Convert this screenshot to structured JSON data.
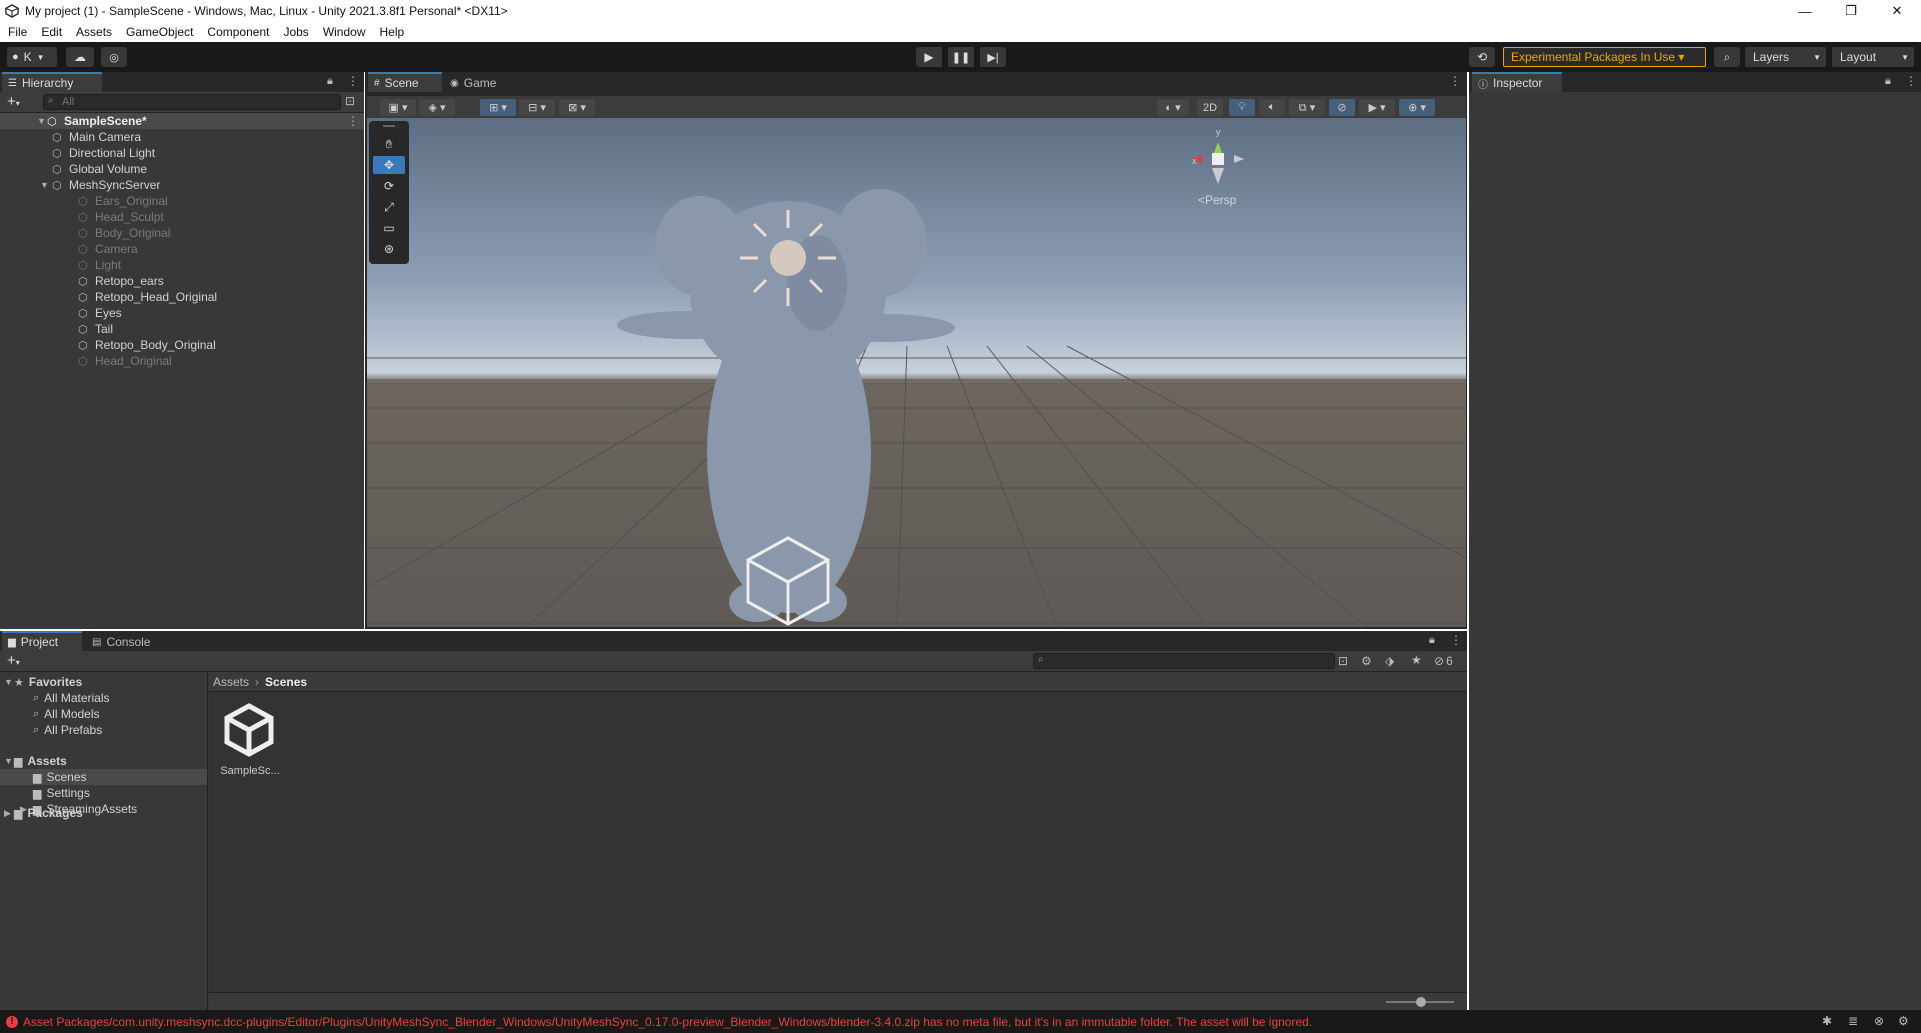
{
  "window": {
    "title": "My project (1) - SampleScene - Windows, Mac, Linux - Unity 2021.3.8f1 Personal* <DX11>",
    "minimize": "—",
    "maximize": "❐",
    "close": "✕"
  },
  "menu": [
    "File",
    "Edit",
    "Assets",
    "GameObject",
    "Component",
    "Jobs",
    "Window",
    "Help"
  ],
  "toolbar": {
    "account_label": "K",
    "experimental_label": "Experimental Packages In Use ▾",
    "layers_label": "Layers",
    "layout_label": "Layout"
  },
  "hierarchy": {
    "tab": "Hierarchy",
    "search_placeholder": "All",
    "scene": "SampleScene*",
    "items": [
      {
        "label": "Main Camera",
        "dim": false
      },
      {
        "label": "Directional Light",
        "dim": false
      },
      {
        "label": "Global Volume",
        "dim": false
      },
      {
        "label": "MeshSyncServer",
        "dim": false
      },
      {
        "label": "Ears_Original",
        "dim": true
      },
      {
        "label": "Head_Sculpt",
        "dim": true
      },
      {
        "label": "Body_Original",
        "dim": true
      },
      {
        "label": "Camera",
        "dim": true
      },
      {
        "label": "Light",
        "dim": true
      },
      {
        "label": "Retopo_ears",
        "dim": false
      },
      {
        "label": "Retopo_Head_Original",
        "dim": false
      },
      {
        "label": "Eyes",
        "dim": false
      },
      {
        "label": "Tail",
        "dim": false
      },
      {
        "label": "Retopo_Body_Original",
        "dim": false
      },
      {
        "label": "Head_Original",
        "dim": true
      }
    ]
  },
  "scene": {
    "tab_scene": "Scene",
    "tab_game": "Game",
    "btn_2d": "2D",
    "gizmo_persp": "<Persp",
    "gizmo_x": "x",
    "gizmo_y": "y"
  },
  "inspector": {
    "tab": "Inspector"
  },
  "project": {
    "tab_project": "Project",
    "tab_console": "Console",
    "hidden_count": "6",
    "breadcrumb_root": "Assets",
    "breadcrumb_sep": "›",
    "breadcrumb_current": "Scenes",
    "favorites": "Favorites",
    "fav_items": [
      "All Materials",
      "All Models",
      "All Prefabs"
    ],
    "assets": "Assets",
    "asset_items": [
      "Scenes",
      "Settings",
      "StreamingAssets"
    ],
    "packages": "Packages",
    "file_label": "SampleSc..."
  },
  "status": {
    "message": "Asset Packages/com.unity.meshsync.dcc-plugins/Editor/Plugins/UnityMeshSync_Blender_Windows/UnityMeshSync_0.17.0-preview_Blender_Windows/blender-3.4.0.zip has no meta file, but it's in an immutable folder. The asset will be ignored.",
    "color_error": "#e84040"
  },
  "colors": {
    "accent": "#3a79bb",
    "warning": "#f0a400",
    "panel_bg": "#383838"
  }
}
